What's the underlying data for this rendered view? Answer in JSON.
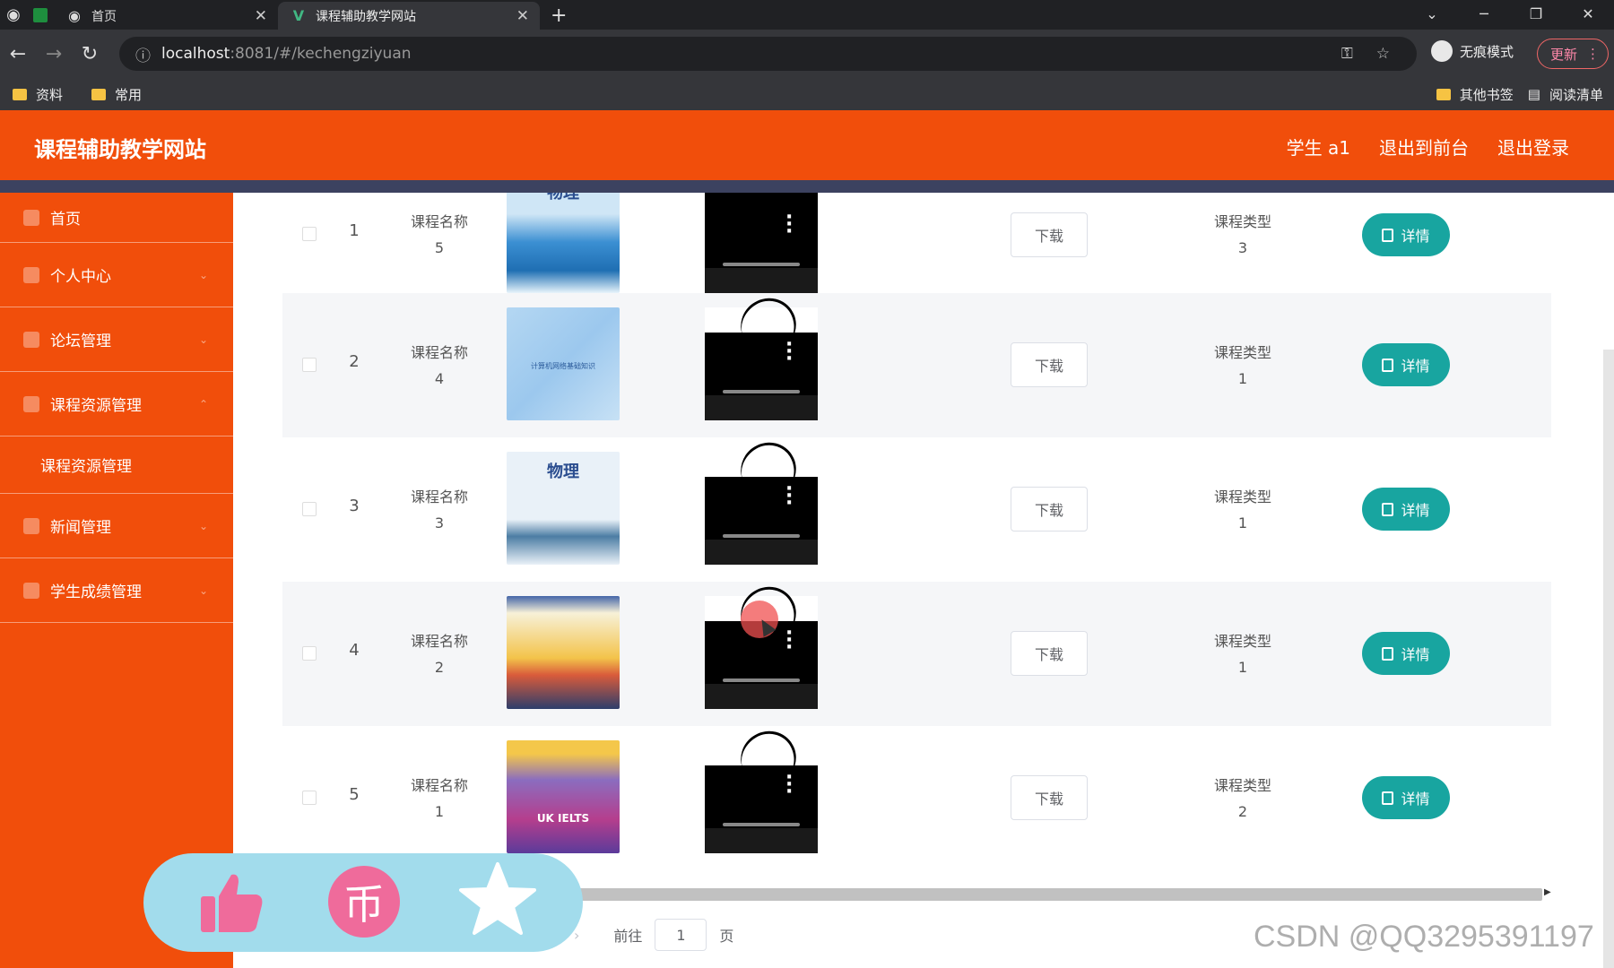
{
  "browser": {
    "tabs": [
      {
        "label": "首页"
      },
      {
        "label": "课程辅助教学网站"
      }
    ],
    "url_host": "localhost",
    "url_path": ":8081/#/kechengziyuan",
    "incognito_label": "无痕模式",
    "update_label": "更新",
    "bookmarks": [
      "资料",
      "常用"
    ],
    "bookmarks_right": [
      "其他书签",
      "阅读清单"
    ]
  },
  "header": {
    "title": "课程辅助教学网站",
    "links": [
      "学生 a1",
      "退出到前台",
      "退出登录"
    ]
  },
  "sidebar": {
    "items": [
      {
        "label": "首页",
        "icon": "home-icon"
      },
      {
        "label": "个人中心",
        "icon": "user-icon"
      },
      {
        "label": "论坛管理",
        "icon": "forum-icon"
      },
      {
        "label": "课程资源管理",
        "icon": "list-icon"
      },
      {
        "label": "课程资源管理",
        "sub": true
      },
      {
        "label": "新闻管理",
        "icon": "news-icon"
      },
      {
        "label": "学生成绩管理",
        "icon": "score-icon"
      }
    ]
  },
  "table": {
    "download_label": "下载",
    "detail_label": "详情",
    "rows": [
      {
        "index": "1",
        "name_label": "课程名称",
        "name": "5",
        "type_label": "课程类型",
        "type": "3",
        "cover_title": "物理"
      },
      {
        "index": "2",
        "name_label": "课程名称",
        "name": "4",
        "type_label": "课程类型",
        "type": "1",
        "cover_title": "计算机网络基础知识"
      },
      {
        "index": "3",
        "name_label": "课程名称",
        "name": "3",
        "type_label": "课程类型",
        "type": "1",
        "cover_title": "物理"
      },
      {
        "index": "4",
        "name_label": "课程名称",
        "name": "2",
        "type_label": "课程类型",
        "type": "1",
        "cover_title": ""
      },
      {
        "index": "5",
        "name_label": "课程名称",
        "name": "1",
        "type_label": "课程类型",
        "type": "2",
        "cover_title": "UK IELTS"
      }
    ]
  },
  "pager": {
    "goto_label": "前往",
    "page_value": "1",
    "page_suffix": "页"
  },
  "watermark": "CSDN @QQ3295391197",
  "colors": {
    "brand": "#f14e0b",
    "detail_button": "#18a5a0",
    "float_panel": "#a2dcec"
  }
}
